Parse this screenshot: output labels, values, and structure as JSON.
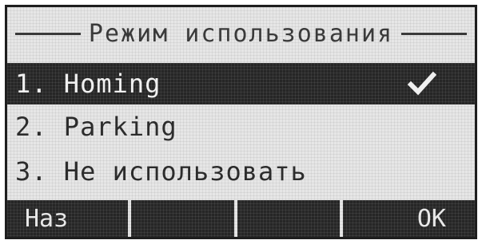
{
  "screen": {
    "title": "Режим использования"
  },
  "menu": {
    "items": [
      {
        "label": "1. Homing",
        "selected": true,
        "checked": true
      },
      {
        "label": "2. Parking",
        "selected": false,
        "checked": false
      },
      {
        "label": "3. Не использовать",
        "selected": false,
        "checked": false
      }
    ]
  },
  "softkeys": {
    "back_label": "Наз",
    "key2_label": "",
    "key3_label": "",
    "ok_label": "OK"
  },
  "icons": {
    "check": "checkmark-icon"
  }
}
